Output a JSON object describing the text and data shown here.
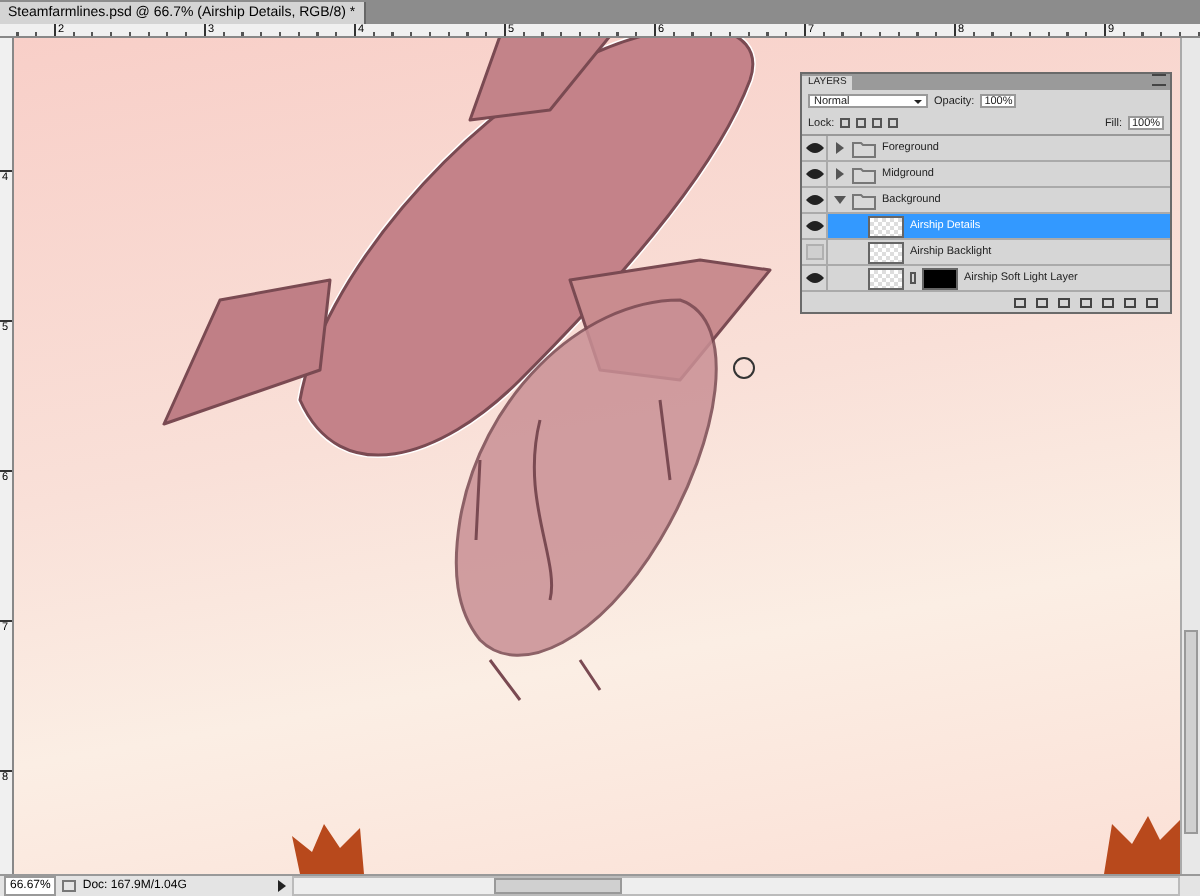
{
  "document_tab": {
    "title": "Steamfarmlines.psd @ 66.7% (Airship Details, RGB/8) *"
  },
  "rulers": {
    "horizontal": [
      "2",
      "3",
      "4",
      "5",
      "6",
      "7",
      "8",
      "9"
    ],
    "vertical": [
      "4",
      "5",
      "6",
      "7",
      "8"
    ]
  },
  "layers_panel": {
    "title": "LAYERS",
    "blend_mode": "Normal",
    "opacity_label": "Opacity:",
    "opacity": "100%",
    "lock_label": "Lock:",
    "fill_label": "Fill:",
    "fill": "100%",
    "layers": [
      {
        "name": "Foreground",
        "kind": "group",
        "visible": true,
        "expanded": false,
        "selected": false
      },
      {
        "name": "Midground",
        "kind": "group",
        "visible": true,
        "expanded": false,
        "selected": false
      },
      {
        "name": "Background",
        "kind": "group",
        "visible": true,
        "expanded": true,
        "selected": false,
        "children": [
          {
            "name": "Airship Details",
            "kind": "layer",
            "visible": true,
            "selected": true
          },
          {
            "name": "Airship Backlight",
            "kind": "layer",
            "visible": false,
            "selected": false
          },
          {
            "name": "Airship Soft Light Layer",
            "kind": "masked",
            "visible": true,
            "selected": false
          }
        ]
      }
    ]
  },
  "status_bar": {
    "zoom": "66.67%",
    "doc_info": "Doc: 167.9M/1.04G"
  }
}
